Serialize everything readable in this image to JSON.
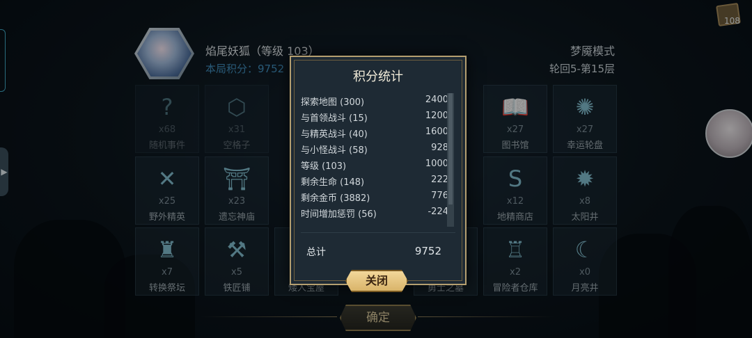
{
  "header": {
    "character_name": "焰尾妖狐（等级 103）",
    "score_line": "本局积分：9752",
    "mode": "梦魇模式",
    "floor": "轮回5-第15层"
  },
  "cards_count": "108",
  "tiles": [
    {
      "icon": "question-icon",
      "glyph": "?",
      "count": "x68",
      "label": "随机事件"
    },
    {
      "icon": "hexagon-icon",
      "glyph": "⬡",
      "count": "x31",
      "label": "空格子"
    },
    {
      "icon": "book-icon",
      "glyph": "📖",
      "count": "x27",
      "label": "图书馆"
    },
    {
      "icon": "wheel-icon",
      "glyph": "✺",
      "count": "x27",
      "label": "幸运轮盘"
    },
    {
      "icon": "crossed-axes-icon",
      "glyph": "✕",
      "count": "x25",
      "label": "野外精英"
    },
    {
      "icon": "temple-icon",
      "glyph": "⛩",
      "count": "x23",
      "label": "遗忘神庙"
    },
    {
      "icon": "shop-icon",
      "glyph": "S",
      "count": "x12",
      "label": "地精商店"
    },
    {
      "icon": "sun-icon",
      "glyph": "✹",
      "count": "x8",
      "label": "太阳井"
    },
    {
      "icon": "altar-icon",
      "glyph": "♜",
      "count": "x7",
      "label": "转换祭坛"
    },
    {
      "icon": "anvil-icon",
      "glyph": "⚒",
      "count": "x5",
      "label": "铁匠铺"
    },
    {
      "icon": "treasure-icon",
      "glyph": "◆",
      "count": "",
      "label": "矮人宝屋"
    },
    {
      "icon": "tomb-icon",
      "glyph": "▮",
      "count": "",
      "label": "勇士之墓"
    },
    {
      "icon": "warehouse-icon",
      "glyph": "♖",
      "count": "x2",
      "label": "冒险者仓库"
    },
    {
      "icon": "moon-well-icon",
      "glyph": "☾",
      "count": "x0",
      "label": "月亮井"
    }
  ],
  "modal": {
    "title": "积分统计",
    "rows": [
      {
        "k": "探索地图 (300)",
        "v": "2400"
      },
      {
        "k": "与首领战斗 (15)",
        "v": "1200"
      },
      {
        "k": "与精英战斗 (40)",
        "v": "1600"
      },
      {
        "k": "与小怪战斗 (58)",
        "v": "928"
      },
      {
        "k": "等级 (103)",
        "v": "1000"
      },
      {
        "k": "剩余生命 (148)",
        "v": "222"
      },
      {
        "k": "剩余金币 (3882)",
        "v": "776"
      },
      {
        "k": "时间增加惩罚 (56)",
        "v": "-224"
      }
    ],
    "total_label": "总计",
    "total_value": "9752",
    "close_label": "关闭"
  },
  "confirm_label": "确定"
}
